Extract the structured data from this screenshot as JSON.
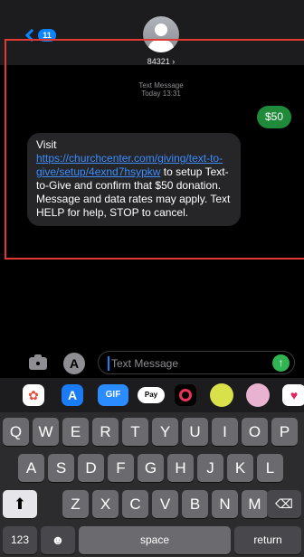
{
  "header": {
    "back_badge": "11",
    "contact": "84321 ›"
  },
  "thread": {
    "label": "Text Message",
    "time": "Today 13:31",
    "sent_message": "$50",
    "received": {
      "text_before": "Visit ",
      "link": "https://churchcenter.com/giving/text-to-give/setup/4exnd7hsypkw",
      "text_after": " to setup Text-to-Give and confirm that $50 donation. Message and data rates may apply. Text HELP for help, STOP to cancel."
    }
  },
  "input": {
    "placeholder": "Text Message"
  },
  "app_strip": {
    "gif": "GIF",
    "pay": "Pay"
  },
  "keyboard": {
    "row1": [
      "Q",
      "W",
      "E",
      "R",
      "T",
      "Y",
      "U",
      "I",
      "O",
      "P"
    ],
    "row2": [
      "A",
      "S",
      "D",
      "F",
      "G",
      "H",
      "J",
      "K",
      "L"
    ],
    "row3": [
      "Z",
      "X",
      "C",
      "V",
      "B",
      "N",
      "M"
    ],
    "numbers": "123",
    "space": "space",
    "return": "return"
  },
  "colors": {
    "accent": "#0a84ff",
    "sent_bubble": "#1f8b3a",
    "received_bubble": "#262628",
    "highlight_box": "#e03a32"
  }
}
